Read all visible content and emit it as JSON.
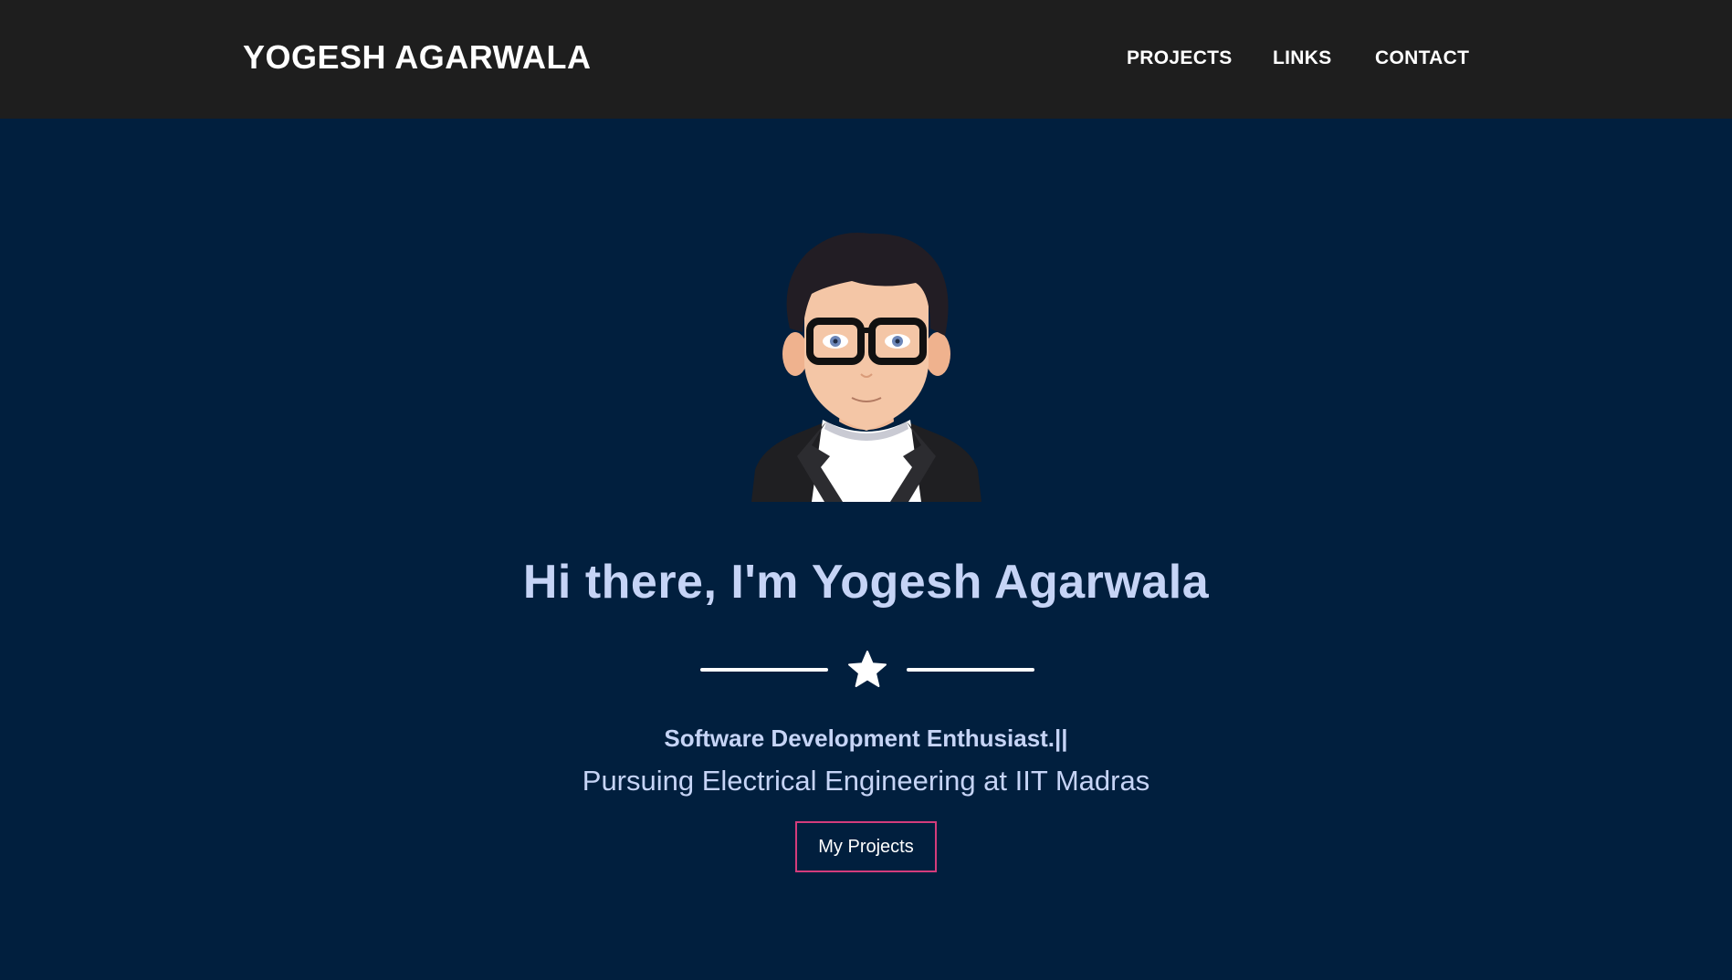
{
  "header": {
    "brand": "YOGESH AGARWALA",
    "nav": [
      {
        "label": "PROJECTS"
      },
      {
        "label": "LINKS"
      },
      {
        "label": "CONTACT"
      }
    ]
  },
  "hero": {
    "avatar_alt": "avatar",
    "title": "Hi there, I'm Yogesh Agarwala",
    "divider_icon": "star-icon",
    "tagline": "Software Development Enthusiast.||",
    "subtitle": "Pursuing Electrical Engineering at IIT Madras",
    "cta_label": "My Projects"
  },
  "colors": {
    "navbar_bg": "#1e1e1e",
    "page_bg": "#011f3e",
    "heading_text": "#c6d4f6",
    "button_border": "#d43c7c"
  }
}
